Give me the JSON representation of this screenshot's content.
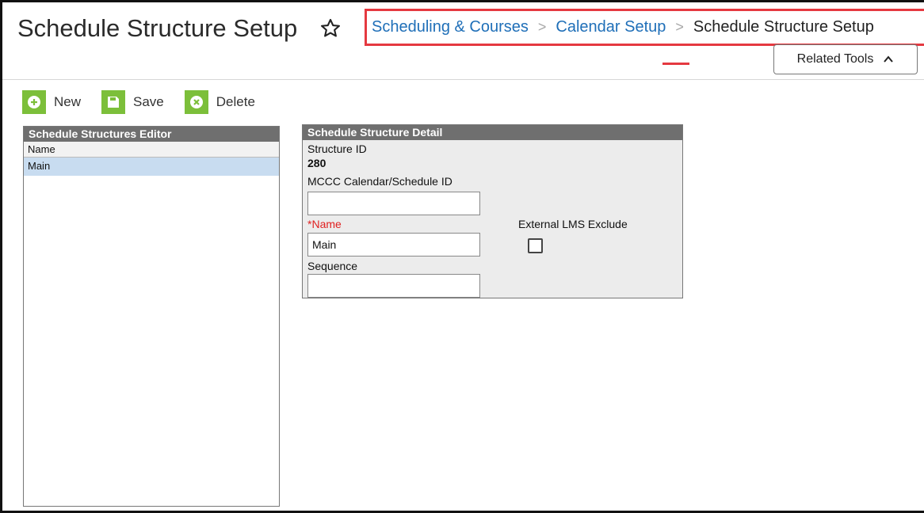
{
  "header": {
    "title": "Schedule Structure Setup",
    "breadcrumb": [
      {
        "label": "Scheduling & Courses"
      },
      {
        "label": "Calendar Setup"
      },
      {
        "label": "Schedule Structure Setup"
      }
    ],
    "related_tools_label": "Related Tools"
  },
  "toolbar": {
    "new_label": "New",
    "save_label": "Save",
    "delete_label": "Delete"
  },
  "editor": {
    "title": "Schedule Structures Editor",
    "column_header": "Name",
    "rows": [
      {
        "name": "Main"
      }
    ]
  },
  "detail": {
    "title": "Schedule Structure Detail",
    "structure_id_label": "Structure ID",
    "structure_id_value": "280",
    "mccc_label": "MCCC Calendar/Schedule ID",
    "mccc_value": "",
    "name_required_mark": "*",
    "name_label": "Name",
    "name_value": "Main",
    "sequence_label": "Sequence",
    "sequence_value": "",
    "external_lms_label": "External LMS Exclude",
    "external_lms_checked": false
  },
  "colors": {
    "accent_green": "#7cbf3a",
    "link_blue": "#1f6fb8",
    "highlight_red": "#e53940",
    "selected_row": "#c8dcf0",
    "panel_header": "#6f6f6f"
  }
}
